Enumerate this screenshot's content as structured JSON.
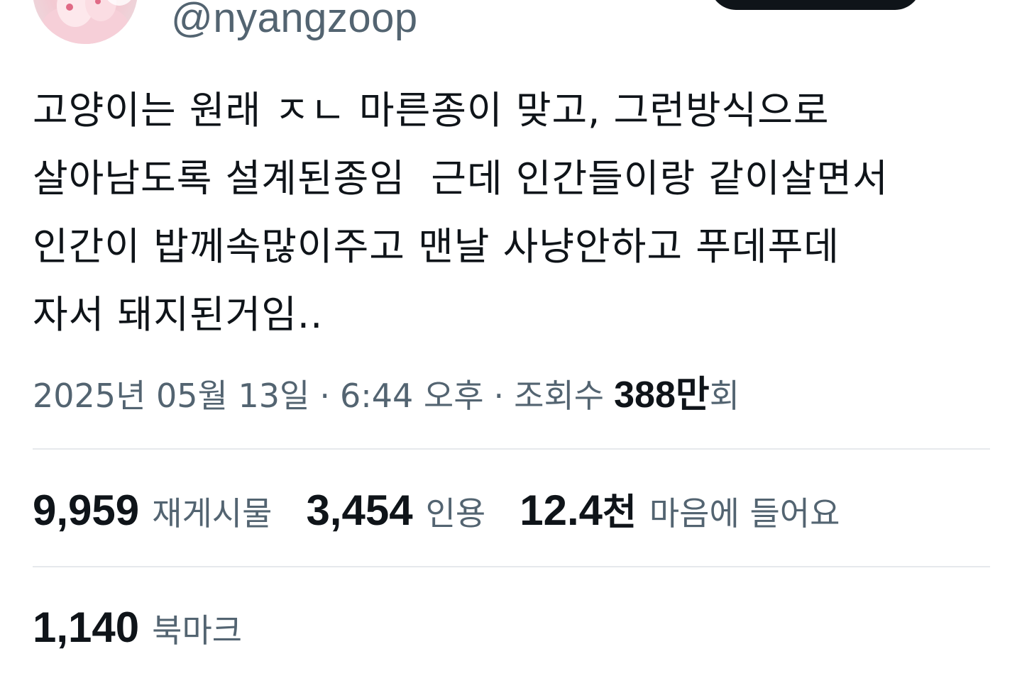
{
  "author": {
    "handle": "@nyangzoop"
  },
  "tweet": {
    "lines": [
      "고양이는 원래 ㅈㄴ 마른종이 맞고, 그런방식으로",
      "살아남도록 설계된종임  근데 인간들이랑 같이살면서",
      "인간이 밥께속많이주고 맨날 사냥안하고 푸데푸데",
      "자서 돼지된거임.."
    ]
  },
  "meta": {
    "date": "2025년 05월 13일",
    "separator": "·",
    "time": "6:44 오후",
    "views_label": "조회수",
    "views_number": "388만",
    "views_suffix": "회"
  },
  "stats": {
    "reposts": {
      "value": "9,959",
      "label": "재게시물"
    },
    "quotes": {
      "value": "3,454",
      "label": "인용"
    },
    "likes": {
      "value": "12.4",
      "unit": "천",
      "label": "마음에 들어요"
    },
    "bookmarks": {
      "value": "1,140",
      "label": "북마크"
    }
  },
  "colors": {
    "text_primary": "#0f1419",
    "text_secondary": "#536471",
    "divider": "#e6e9ec",
    "button_bg": "#0f1419"
  },
  "icons": {
    "avatar": "avatar-image"
  }
}
